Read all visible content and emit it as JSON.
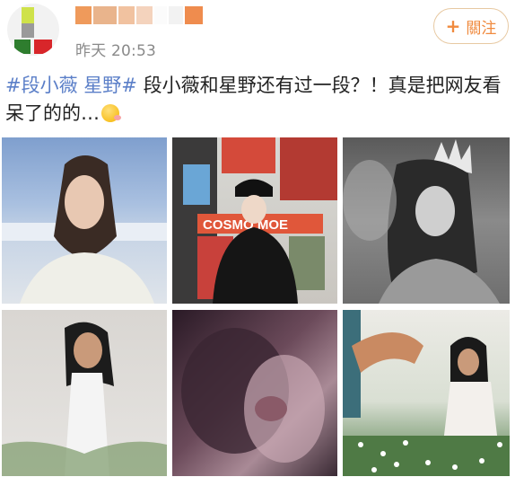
{
  "header": {
    "timestamp": "昨天 20:53",
    "follow_button": {
      "label": "關注",
      "icon": "plus-icon"
    }
  },
  "post": {
    "hashtag_1": "#段小薇",
    "hashtag_2": "星野#",
    "text": " 段小薇和星野还有过一段？！真是把网友看呆了的的…",
    "emoji": "smiling-emoji-icon"
  },
  "photos": [
    {
      "subject": "woman-long-hair-seaside"
    },
    {
      "subject": "person-black-bucket-hat-posters"
    },
    {
      "subject": "person-crown-monochrome"
    },
    {
      "subject": "woman-white-dress-grass"
    },
    {
      "subject": "close-up-kiss-purple"
    },
    {
      "subject": "woman-white-dress-flowers"
    }
  ]
}
